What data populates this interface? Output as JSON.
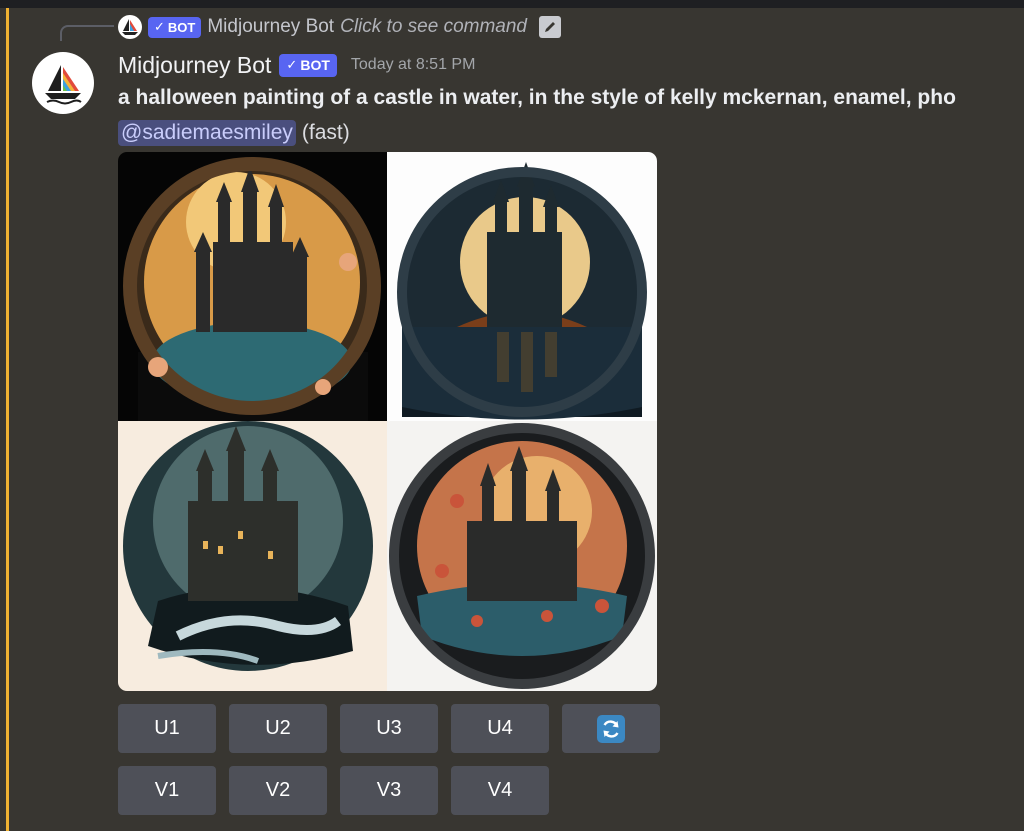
{
  "reply": {
    "bot_name": "Midjourney Bot",
    "bot_tag": "BOT",
    "command_hint": "Click to see command"
  },
  "message": {
    "author": "Midjourney Bot",
    "bot_tag": "BOT",
    "timestamp": "Today at 8:51 PM",
    "prompt": "a halloween painting of a castle in water, in the style of kelly mckernan, enamel, pho",
    "mention": "@sadiemaesmiley",
    "mode": "(fast)"
  },
  "images": {
    "tile_1": "castle-image-1",
    "tile_2": "castle-image-2",
    "tile_3": "castle-image-3",
    "tile_4": "castle-image-4"
  },
  "buttons": {
    "upscale": [
      "U1",
      "U2",
      "U3",
      "U4"
    ],
    "variation": [
      "V1",
      "V2",
      "V3",
      "V4"
    ],
    "reroll_icon": "reroll-icon"
  },
  "colors": {
    "accent_blurple": "#5865f2",
    "mention_bar": "#f0b232",
    "button_bg": "#4e5058",
    "reroll_blue": "#3b88c3"
  }
}
